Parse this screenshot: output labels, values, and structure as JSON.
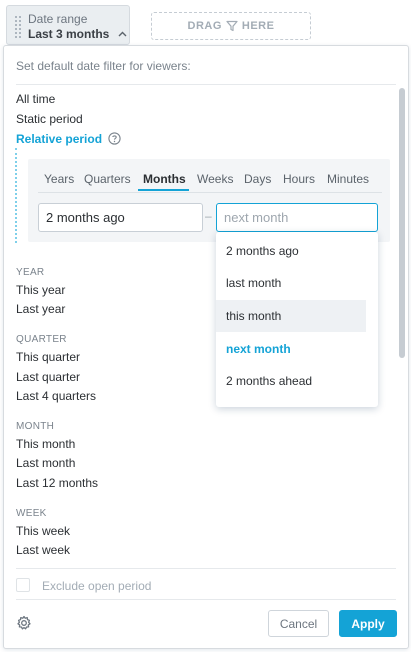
{
  "filter_chip": {
    "label": "Date range",
    "value": "Last 3 months",
    "grip_icon": "drag-grip-icon",
    "caret_icon": "chevron-up-icon"
  },
  "drag_zone": {
    "text_left": "DRAG",
    "text_right": "HERE",
    "icon": "filter-funnel-icon"
  },
  "panel": {
    "description": "Set default date filter for viewers:",
    "options": [
      "All time",
      "Static period",
      "Relative period"
    ],
    "relative": {
      "tabs": [
        "Years",
        "Quarters",
        "Months",
        "Weeks",
        "Days",
        "Hours",
        "Minutes"
      ],
      "active_tab": "Months",
      "from_value": "2 months ago",
      "to_placeholder": "next month",
      "separator": "–",
      "dropdown_items": [
        "2 months ago",
        "last month",
        "this month",
        "next month",
        "2 months ahead"
      ],
      "dropdown_hover": "this month",
      "dropdown_selected": "next month"
    },
    "groups": [
      {
        "heading": "YEAR",
        "items": [
          "This year",
          "Last year"
        ]
      },
      {
        "heading": "QUARTER",
        "items": [
          "This quarter",
          "Last quarter",
          "Last 4 quarters"
        ]
      },
      {
        "heading": "MONTH",
        "items": [
          "This month",
          "Last month",
          "Last 12 months"
        ]
      },
      {
        "heading": "WEEK",
        "items": [
          "This week",
          "Last week"
        ]
      }
    ],
    "exclude_label": "Exclude open period",
    "exclude_checked": false,
    "cancel_label": "Cancel",
    "apply_label": "Apply",
    "settings_icon": "gear-icon"
  },
  "colors": {
    "accent": "#14a3d6",
    "text": "#2b2f33",
    "muted": "#7a838c"
  }
}
